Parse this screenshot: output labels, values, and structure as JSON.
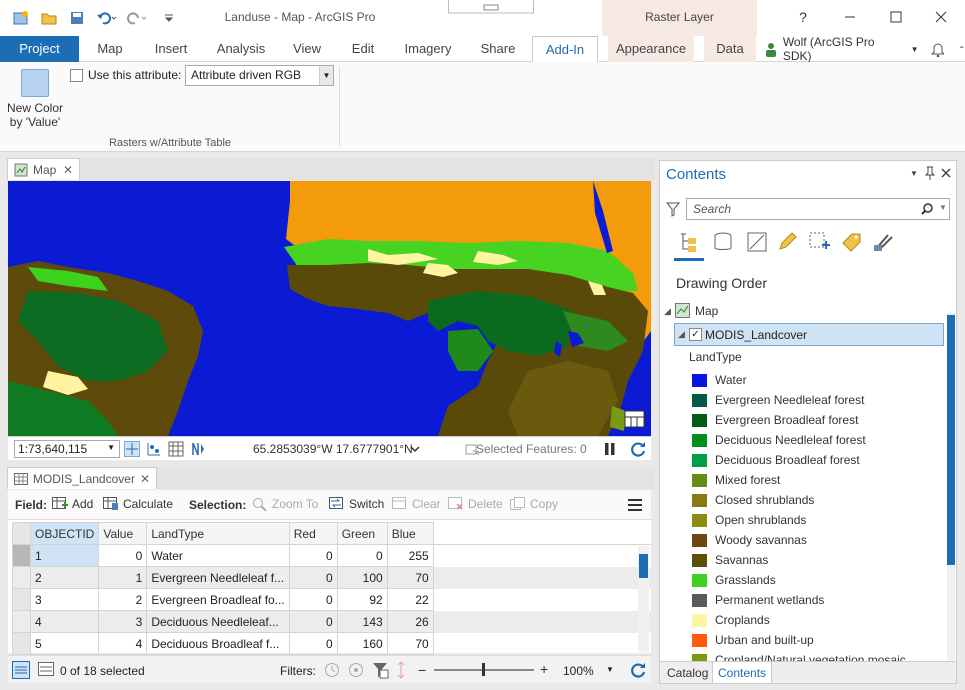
{
  "app": {
    "title": "Landuse - Map - ArcGIS Pro",
    "context_tab_group": "Raster Layer",
    "user": "Wolf (ArcGIS Pro SDK)",
    "help_label": "?"
  },
  "tabs": [
    "Project",
    "Map",
    "Insert",
    "Analysis",
    "View",
    "Edit",
    "Imagery",
    "Share",
    "Add-In",
    "Appearance",
    "Data"
  ],
  "active_tab": "Add-In",
  "ribbon": {
    "new_color_label_1": "New Color",
    "new_color_label_2": "by 'Value'",
    "use_attribute_label": "Use this attribute:",
    "attribute_value": "Attribute driven RGB",
    "group_label": "Rasters w/Attribute Table"
  },
  "map_view": {
    "tab_label": "Map",
    "scale": "1:73,640,115",
    "coordinates": "65.2853039°W 17.6777901°N",
    "selected_features": "Selected Features: 0"
  },
  "attribute_table": {
    "tab_label": "MODIS_Landcover",
    "field_label": "Field:",
    "add_label": "Add",
    "calculate_label": "Calculate",
    "selection_label": "Selection:",
    "zoom_to_label": "Zoom To",
    "switch_label": "Switch",
    "clear_label": "Clear",
    "delete_label": "Delete",
    "copy_label": "Copy",
    "columns": [
      "OBJECTID",
      "Value",
      "LandType",
      "Red",
      "Green",
      "Blue"
    ],
    "rows": [
      [
        "1",
        "0",
        "Water",
        "0",
        "0",
        "255"
      ],
      [
        "2",
        "1",
        "Evergreen Needleleaf f...",
        "0",
        "100",
        "70"
      ],
      [
        "3",
        "2",
        "Evergreen Broadleaf fo...",
        "0",
        "92",
        "22"
      ],
      [
        "4",
        "3",
        "Deciduous Needleleaf...",
        "0",
        "143",
        "26"
      ],
      [
        "5",
        "4",
        "Deciduous Broadleaf f...",
        "0",
        "160",
        "70"
      ]
    ],
    "selected_count": "0 of 18 selected",
    "filters_label": "Filters:",
    "zoom_level": "100%"
  },
  "contents": {
    "title": "Contents",
    "search_placeholder": "Search",
    "drawing_order": "Drawing Order",
    "map_item": "Map",
    "layer_item": "MODIS_Landcover",
    "legend_heading": "LandType",
    "legend": [
      {
        "label": "Water",
        "color": "#0a14e0"
      },
      {
        "label": "Evergreen Needleleaf forest",
        "color": "#005a46"
      },
      {
        "label": "Evergreen Broadleaf forest",
        "color": "#005c16"
      },
      {
        "label": "Deciduous Needleleaf forest",
        "color": "#008f1a"
      },
      {
        "label": "Deciduous Broadleaf forest",
        "color": "#00a046"
      },
      {
        "label": "Mixed forest",
        "color": "#648c1a"
      },
      {
        "label": "Closed shrublands",
        "color": "#8a7a14"
      },
      {
        "label": "Open shrublands",
        "color": "#8c8c10"
      },
      {
        "label": "Woody savannas",
        "color": "#6a4a10"
      },
      {
        "label": "Savannas",
        "color": "#5c5008"
      },
      {
        "label": "Grasslands",
        "color": "#3cd21e"
      },
      {
        "label": "Permanent wetlands",
        "color": "#5a5a5a"
      },
      {
        "label": "Croplands",
        "color": "#fff5a0"
      },
      {
        "label": "Urban and built-up",
        "color": "#ff5a0a"
      },
      {
        "label": "Cropland/Natural vegetation mosaic",
        "color": "#7a9a14"
      }
    ],
    "tab_catalog": "Catalog",
    "tab_contents": "Contents"
  }
}
